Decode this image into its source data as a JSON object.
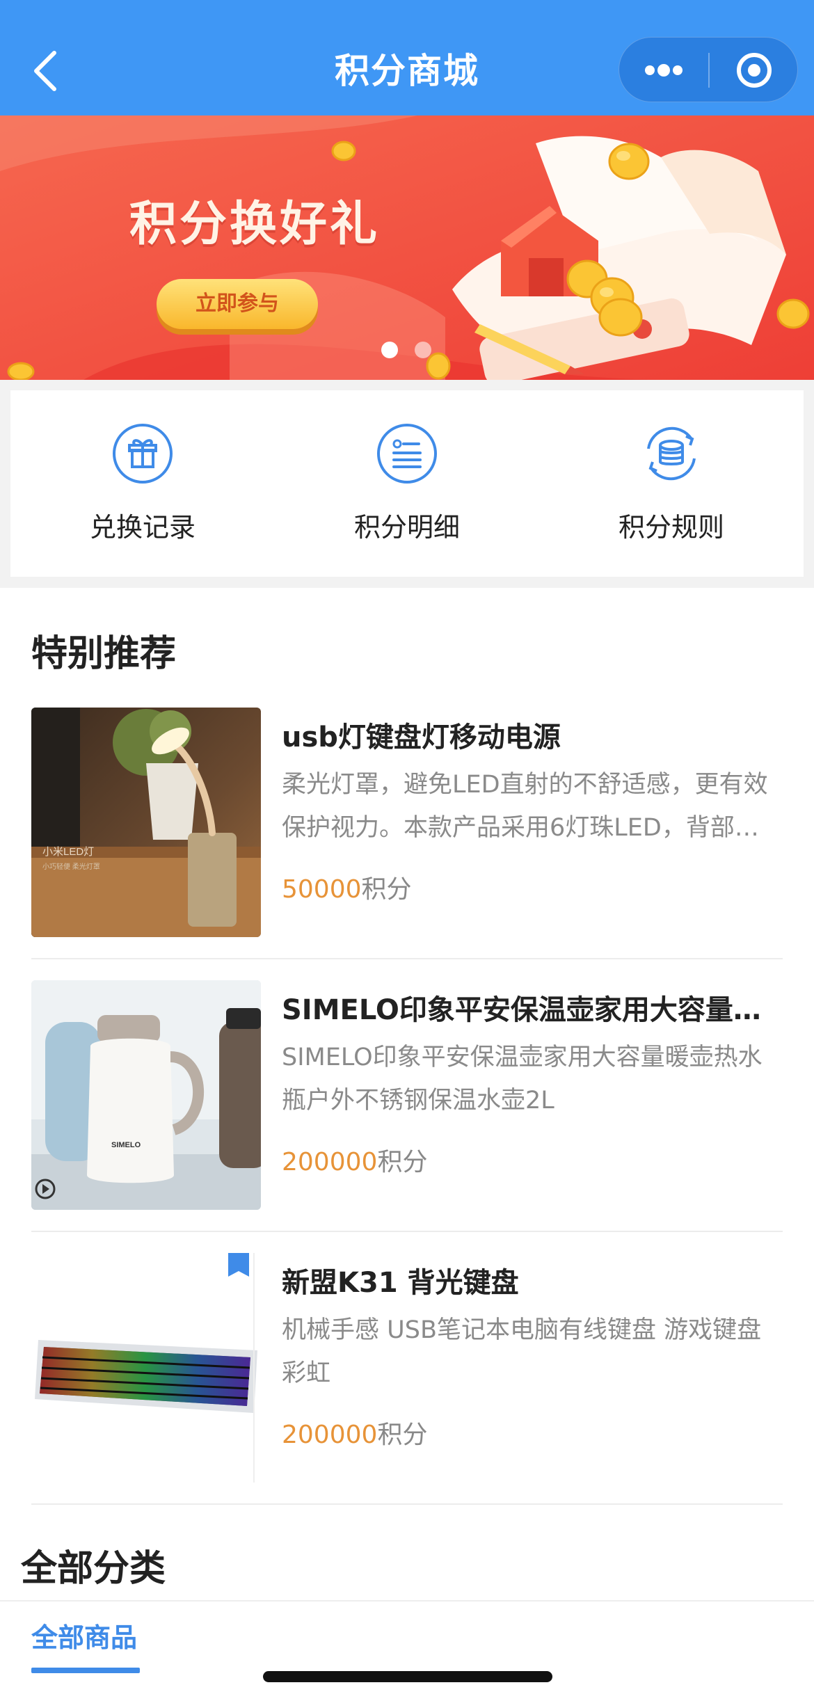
{
  "header": {
    "title": "积分商城",
    "back_icon": "chevron-left-icon",
    "more_icon": "more-dots-icon",
    "target_icon": "target-icon",
    "color": "#3f97f5"
  },
  "banner": {
    "title": "积分换好礼",
    "button_label": "立即参与",
    "active_slide": 1,
    "slide_count": 2
  },
  "quick_menu": [
    {
      "label": "兑换记录",
      "icon": "gift-icon"
    },
    {
      "label": "积分明细",
      "icon": "list-icon"
    },
    {
      "label": "积分规则",
      "icon": "coin-stack-icon"
    }
  ],
  "recommend": {
    "title": "特别推荐",
    "price_unit": "积分",
    "products": [
      {
        "name": "usb灯键盘灯移动电源",
        "desc": "柔光灯罩，避免LED直射的不舒适感，更有效保护视力。本款产品采用6灯珠LED，背部…",
        "price": "50000",
        "img_text_1": "小米LED灯",
        "img_text_2": "小巧轻便 柔光灯罩"
      },
      {
        "name": "SIMELO印象平安保温壶家用大容量…",
        "desc": "SIMELO印象平安保温壶家用大容量暖壶热水瓶户外不锈钢保温水壶2L",
        "price": "200000",
        "img_text_1": "SIMELO"
      },
      {
        "name": "新盟K31 背光键盘",
        "desc": "机械手感 USB笔记本电脑有线键盘 游戏键盘彩虹",
        "price": "200000"
      }
    ]
  },
  "category": {
    "title": "全部分类",
    "tab_label": "全部商品",
    "accent": "#3f8be8"
  }
}
